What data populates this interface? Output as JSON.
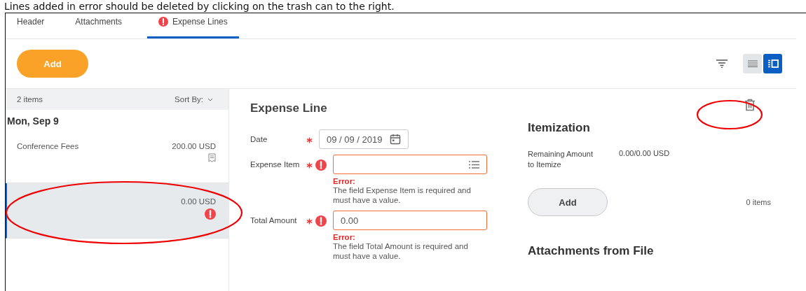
{
  "caption": "Lines added in error should be deleted by clicking on the trash can to the right.",
  "tabs": [
    {
      "label": "Header",
      "selected": false,
      "error": false
    },
    {
      "label": "Attachments",
      "selected": false,
      "error": false
    },
    {
      "label": "Expense Lines",
      "selected": true,
      "error": true
    }
  ],
  "toolbar": {
    "add_label": "Add",
    "views": [
      {
        "kind": "list",
        "selected": false
      },
      {
        "kind": "detail",
        "selected": true
      }
    ]
  },
  "list": {
    "count": "2 items",
    "sort_label": "Sort By:",
    "group": "Mon, Sep 9",
    "lines": [
      {
        "name": "Conference Fees",
        "amount": "200.00 USD",
        "receipt": true,
        "error": false,
        "selected": false
      },
      {
        "amount": "0.00 USD",
        "receipt": false,
        "error": true,
        "selected": true
      }
    ]
  },
  "detail": {
    "title": "Expense Line",
    "fields": [
      {
        "kind": "date",
        "label": "Date",
        "required": true,
        "value": "09 / 09 / 2019",
        "error": false
      },
      {
        "kind": "select",
        "label": "Expense Item",
        "required": true,
        "error": true,
        "error_title": "Error:",
        "error_text": "The field Expense Item is required and must have a value."
      },
      {
        "kind": "text",
        "label": "Total Amount",
        "required": true,
        "value": "0.00",
        "error": true,
        "error_title": "Error:",
        "error_text": "The field Total Amount is required and must have a value."
      }
    ]
  },
  "itemization": {
    "title": "Itemization",
    "remaining_label": "Remaining Amount to Itemize",
    "remaining_value": "0.00/0.00 USD",
    "add_label": "Add",
    "count": "0 items"
  },
  "attachments": {
    "title": "Attachments from File"
  }
}
